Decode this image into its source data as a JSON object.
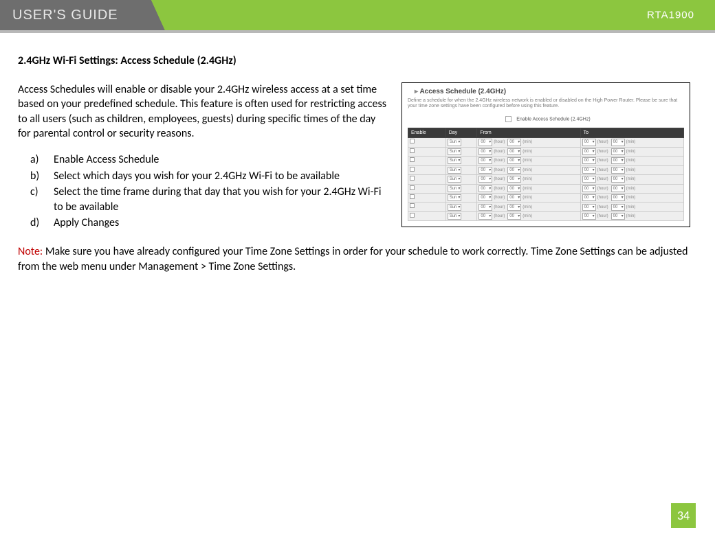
{
  "banner": {
    "left": "USER'S GUIDE",
    "model": "RTA1900"
  },
  "section_title": "2.4GHz Wi-Fi Settings: Access Schedule (2.4GHz)",
  "intro": "Access Schedules will enable or disable your 2.4GHz wireless access at a set time based on your predefined schedule.  This feature is often used for restricting access to all users (such as children, employees, guests) during specific times of the day for parental control or security reasons.",
  "steps": [
    {
      "letter": "a)",
      "text": "Enable Access Schedule"
    },
    {
      "letter": "b)",
      "text": "Select which days you wish for your 2.4GHz Wi-Fi to be available"
    },
    {
      "letter": "c)",
      "text": "Select the time frame during that day that you wish for your 2.4GHz Wi-Fi to be available"
    },
    {
      "letter": "d)",
      "text": "Apply Changes"
    }
  ],
  "note": {
    "label": "Note:",
    "text": "  Make sure you have already configured your Time Zone Settings in order for your schedule to work correctly.  Time Zone Settings can be adjusted from the web menu under Management > Time Zone Settings."
  },
  "screenshot": {
    "title": "Access Schedule (2.4GHz)",
    "desc": "Define a schedule for when the 2.4GHz wireless network is enabled or disabled on the High Power Router. Please be sure that your time zone settings have been configured before using this feature.",
    "enable_label": "Enable Access Schedule (2.4GHz)",
    "headers": {
      "c0": "Enable",
      "c1": "Day",
      "c2": "From",
      "c3": "To"
    },
    "day": "Sun",
    "hour_lbl": "(hour)",
    "min_lbl": "(min)",
    "zero": "00",
    "rows": 9
  },
  "page_number": "34"
}
